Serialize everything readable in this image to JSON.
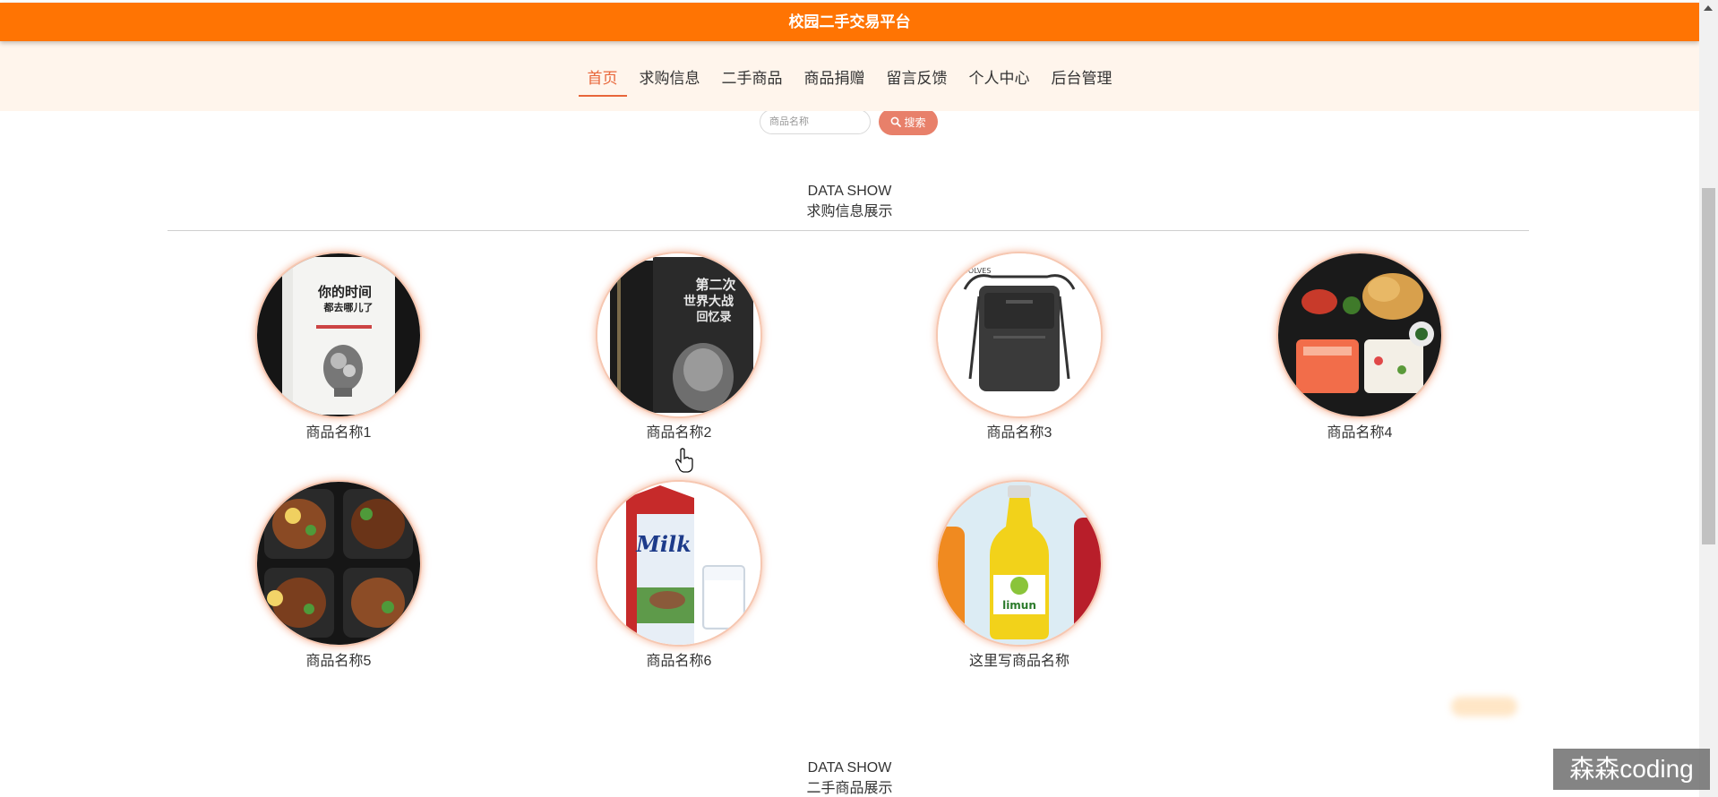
{
  "header": {
    "title": "校园二手交易平台"
  },
  "nav": {
    "items": [
      {
        "label": "首页",
        "active": true
      },
      {
        "label": "求购信息"
      },
      {
        "label": "二手商品"
      },
      {
        "label": "商品捐赠"
      },
      {
        "label": "留言反馈"
      },
      {
        "label": "个人中心"
      },
      {
        "label": "后台管理"
      }
    ]
  },
  "search": {
    "placeholder": "商品名称",
    "button_label": "搜索"
  },
  "sections": [
    {
      "en": "DATA SHOW",
      "zh": "求购信息展示"
    },
    {
      "en": "DATA SHOW",
      "zh": "二手商品展示"
    }
  ],
  "products": [
    {
      "name": "商品名称1",
      "image": "book-cover"
    },
    {
      "name": "商品名称2",
      "image": "book-set-cover"
    },
    {
      "name": "商品名称3",
      "image": "shoulder-bag"
    },
    {
      "name": "商品名称4",
      "image": "bento-box"
    },
    {
      "name": "商品名称5",
      "image": "noodle-bowls"
    },
    {
      "name": "商品名称6",
      "image": "milk-carton"
    },
    {
      "name": "这里写商品名称",
      "image": "juice-bottle"
    }
  ],
  "watermark": "森森coding",
  "colors": {
    "brand": "#ff7403",
    "nav_bg": "#fff5ec",
    "accent": "#e8663a",
    "search_button": "#e8806a"
  }
}
